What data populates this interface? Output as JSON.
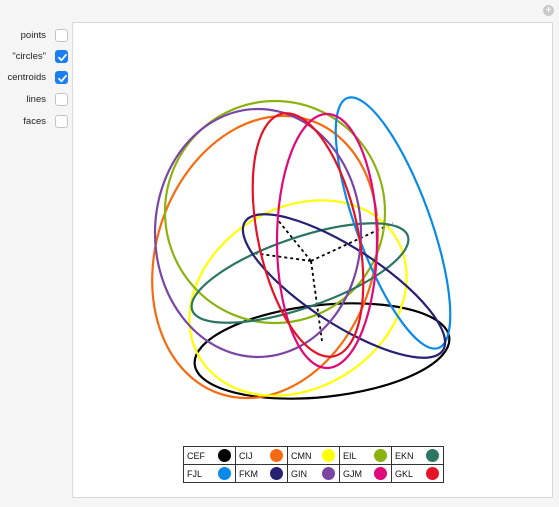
{
  "controls": [
    {
      "label": "points",
      "checked": false
    },
    {
      "label": "\"circles\"",
      "checked": true
    },
    {
      "label": "centroids",
      "checked": true
    },
    {
      "label": "lines",
      "checked": false
    },
    {
      "label": "faces",
      "checked": false
    }
  ],
  "settings_icon": "plus-icon",
  "legend": [
    [
      {
        "label": "CEF",
        "color": "#000000"
      },
      {
        "label": "CIJ",
        "color": "#f76a0f"
      },
      {
        "label": "CMN",
        "color": "#ffff00"
      },
      {
        "label": "EIL",
        "color": "#8ab30f"
      },
      {
        "label": "EKN",
        "color": "#2c7563"
      }
    ],
    [
      {
        "label": "FJL",
        "color": "#0a8ae8"
      },
      {
        "label": "FKM",
        "color": "#272173"
      },
      {
        "label": "GIN",
        "color": "#7b46a3"
      },
      {
        "label": "GJM",
        "color": "#e0097a"
      },
      {
        "label": "GKL",
        "color": "#e51327"
      }
    ]
  ]
}
